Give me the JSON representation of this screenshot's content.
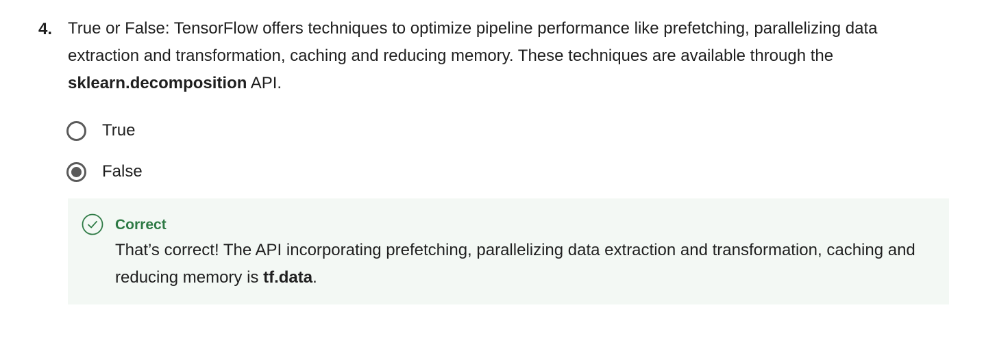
{
  "question": {
    "number": "4.",
    "text_before": "True or False: TensorFlow offers techniques to optimize pipeline performance like prefetching, parallelizing data extraction and transformation, caching and reducing memory. These techniques are available through the ",
    "text_bold": "sklearn.decomposition",
    "text_after": " API."
  },
  "options": [
    {
      "label": "True",
      "selected": false
    },
    {
      "label": "False",
      "selected": true
    }
  ],
  "feedback": {
    "status": "Correct",
    "icon": "check-circle-icon",
    "text_before": "That’s correct! The API incorporating prefetching, parallelizing data extraction and transformation, caching and reducing memory is ",
    "text_bold": "tf.data",
    "text_after": ".",
    "status_color": "#2e7a45",
    "background_color": "#f3f8f4"
  }
}
